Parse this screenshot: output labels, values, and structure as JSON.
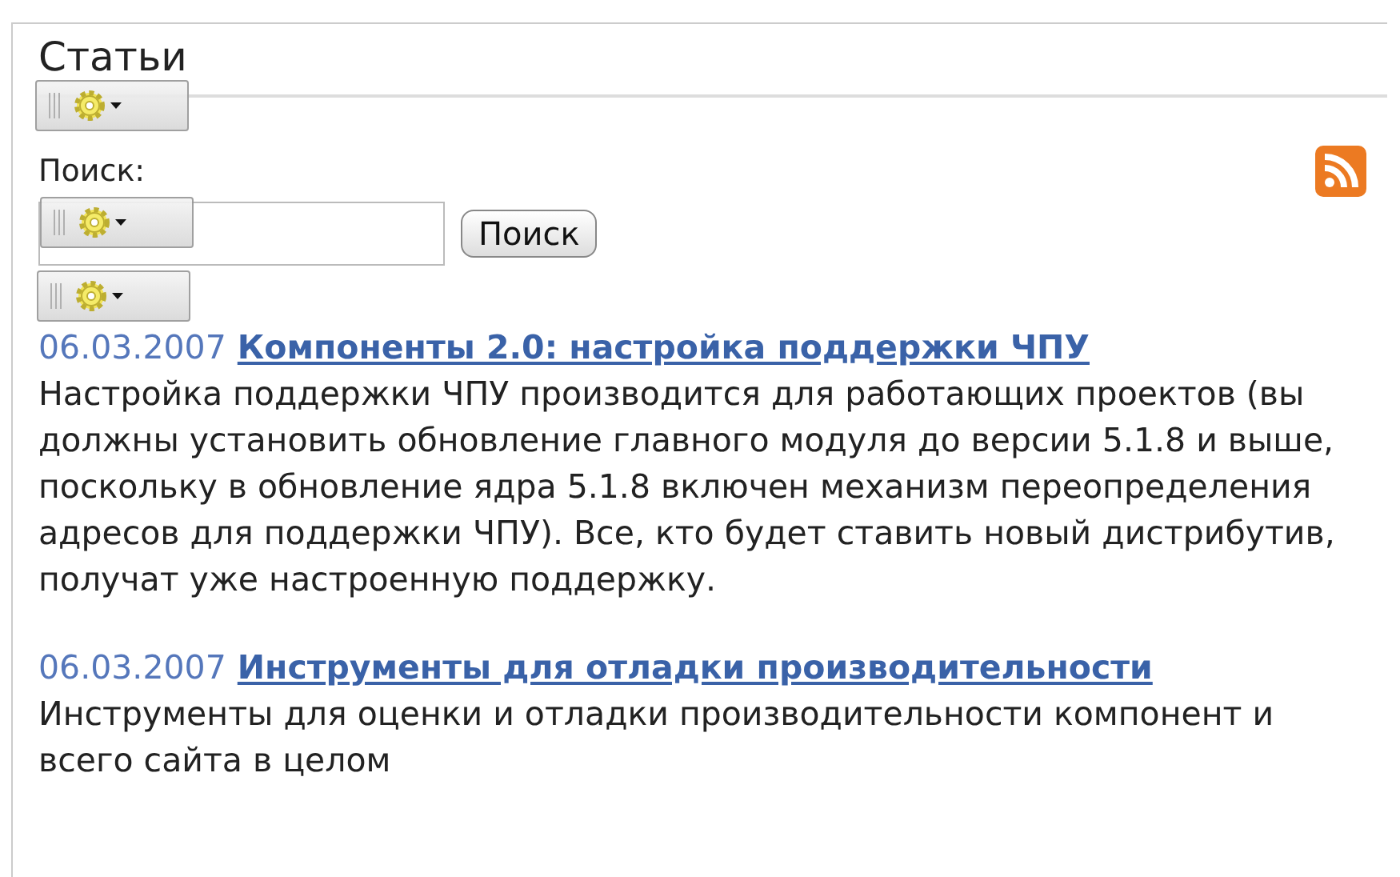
{
  "title": "Статьи",
  "search": {
    "label": "Поиск:",
    "button": "Поиск"
  },
  "articles": [
    {
      "date": "06.03.2007",
      "title": "Компоненты 2.0: настройка поддержки ЧПУ",
      "text": "Настройка поддержки ЧПУ производится для работающих проектов (вы должны установить обновление главного модуля до версии 5.1.8 и выше, поскольку в обновление ядра 5.1.8 включен механизм переопределения адресов для поддержки ЧПУ). Все, кто будет ставить новый дистрибутив, получат уже настроенную поддержку."
    },
    {
      "date": "06.03.2007",
      "title": "Инструменты для отладки производительности",
      "text": "Инструменты для оценки и отладки производительности компонент и всего сайта в целом"
    }
  ]
}
